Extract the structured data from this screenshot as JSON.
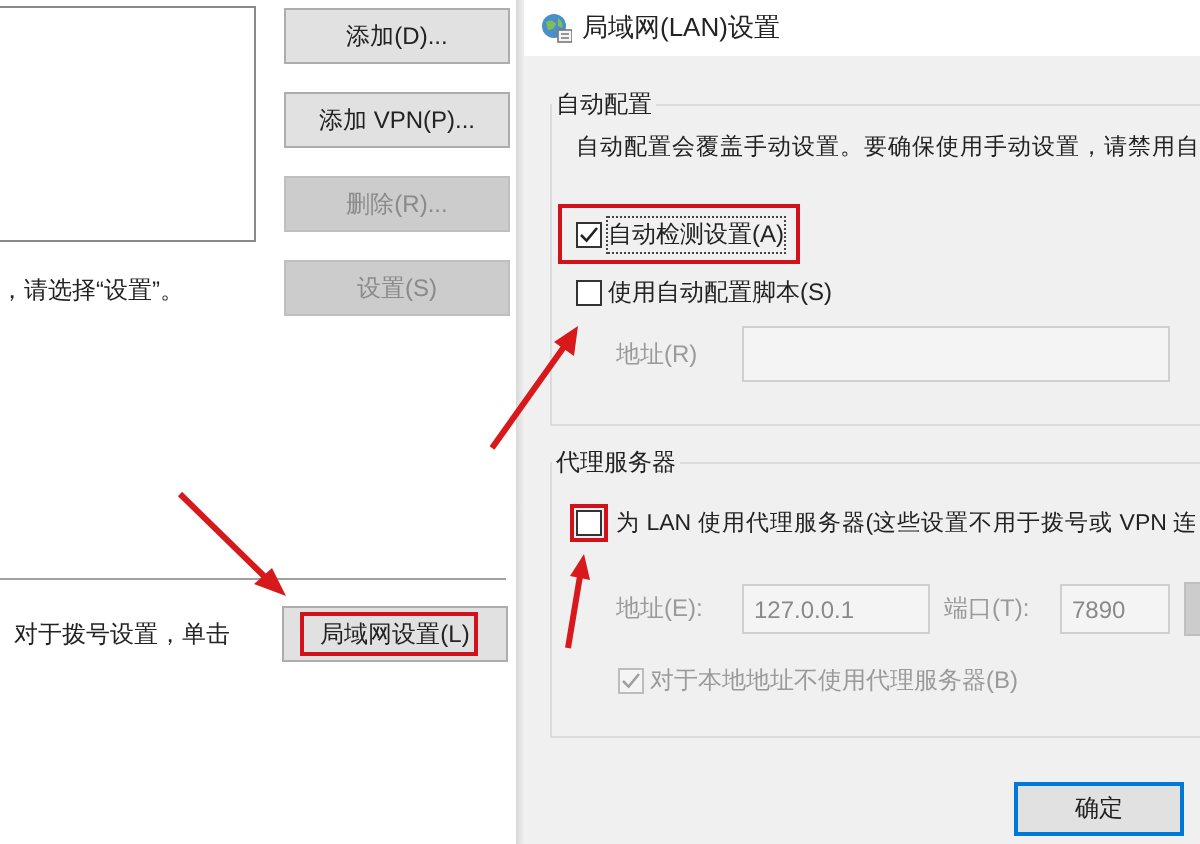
{
  "connections_page": {
    "buttons": [
      {
        "label": "添加(D)...",
        "disabled": false
      },
      {
        "label": "添加 VPN(P)...",
        "disabled": false
      },
      {
        "label": "删除(R)...",
        "disabled": true
      },
      {
        "label": "设置(S)",
        "disabled": true
      }
    ],
    "hint": "，请选择“设置”。",
    "lan_label": "对于拨号设置，单击",
    "lan_button": {
      "label": "局域网设置(L)",
      "highlighted": true,
      "arrow": true
    }
  },
  "lan_dialog": {
    "title": "局域网(LAN)设置",
    "auto_config": {
      "legend": "自动配置",
      "description": "自动配置会覆盖手动设置。要确保使用手动设置，请禁用自",
      "auto_detect": {
        "label": "自动检测设置(A)",
        "checked": true,
        "highlighted": true
      },
      "use_script": {
        "label": "使用自动配置脚本(S)",
        "checked": false,
        "arrow": true
      },
      "address": {
        "label": "地址(R)",
        "disabled": true
      }
    },
    "proxy": {
      "legend": "代理服务器",
      "use_proxy": {
        "label": "为 LAN 使用代理服务器(这些设置不用于拨号或 VPN 连",
        "checked": false,
        "highlighted": true,
        "arrow": true
      },
      "address": {
        "label": "地址(E):",
        "value": "127.0.0.1",
        "disabled": true
      },
      "port": {
        "label": "端口(T):",
        "value": "7890",
        "disabled": true
      },
      "bypass_local": {
        "label": "对于本地地址不使用代理服务器(B)",
        "checked": true,
        "disabled": true
      }
    },
    "ok_button": "确定"
  }
}
